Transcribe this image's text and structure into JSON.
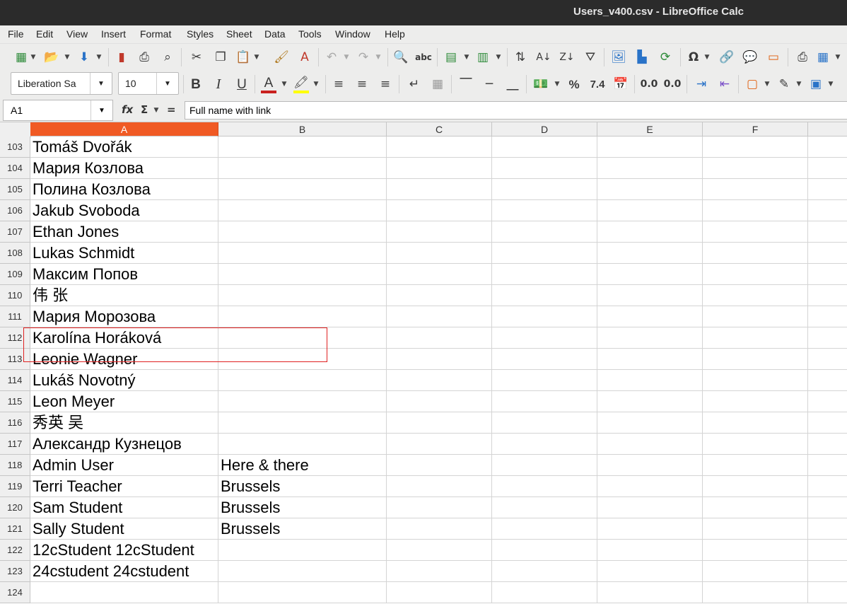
{
  "window": {
    "title": "Users_v400.csv - LibreOffice Calc"
  },
  "menu": [
    "File",
    "Edit",
    "View",
    "Insert",
    "Format",
    "Styles",
    "Sheet",
    "Data",
    "Tools",
    "Window",
    "Help"
  ],
  "font": {
    "name": "Liberation Sa",
    "size": "10"
  },
  "namebox": "A1",
  "formula": {
    "fx": "fx",
    "sigma": "Σ",
    "equals": "=",
    "content": "Full name with link"
  },
  "columns": [
    "A",
    "B",
    "C",
    "D",
    "E",
    "F"
  ],
  "rows": [
    {
      "num": "103",
      "a": "Tomáš Dvořák",
      "b": ""
    },
    {
      "num": "104",
      "a": "Мария Козлова",
      "b": ""
    },
    {
      "num": "105",
      "a": "Полина Козлова",
      "b": ""
    },
    {
      "num": "106",
      "a": "Jakub Svoboda",
      "b": ""
    },
    {
      "num": "107",
      "a": "Ethan Jones",
      "b": ""
    },
    {
      "num": "108",
      "a": "Lukas Schmidt",
      "b": ""
    },
    {
      "num": "109",
      "a": "Максим Попов",
      "b": ""
    },
    {
      "num": "110",
      "a": "伟 张",
      "b": ""
    },
    {
      "num": "111",
      "a": "Мария Морозова",
      "b": ""
    },
    {
      "num": "112",
      "a": "Karolína Horáková",
      "b": ""
    },
    {
      "num": "113",
      "a": "Leonie Wagner",
      "b": ""
    },
    {
      "num": "114",
      "a": "Lukáš Novotný",
      "b": ""
    },
    {
      "num": "115",
      "a": "Leon Meyer",
      "b": ""
    },
    {
      "num": "116",
      "a": "秀英 吴",
      "b": ""
    },
    {
      "num": "117",
      "a": "Александр Кузнецов",
      "b": ""
    },
    {
      "num": "118",
      "a": "Admin User",
      "b": "Here & there"
    },
    {
      "num": "119",
      "a": "Terri Teacher",
      "b": "Brussels"
    },
    {
      "num": "120",
      "a": "Sam Student",
      "b": "Brussels"
    },
    {
      "num": "121",
      "a": "Sally Student",
      "b": "Brussels"
    },
    {
      "num": "122",
      "a": "12cStudent 12cStudent",
      "b": ""
    },
    {
      "num": "123",
      "a": "24cstudent 24cstudent",
      "b": ""
    },
    {
      "num": "124",
      "a": "",
      "b": ""
    }
  ],
  "colors": {
    "active_header": "#f05a24",
    "highlight_box": "#e02020",
    "titlebar": "#2b2b2b"
  }
}
